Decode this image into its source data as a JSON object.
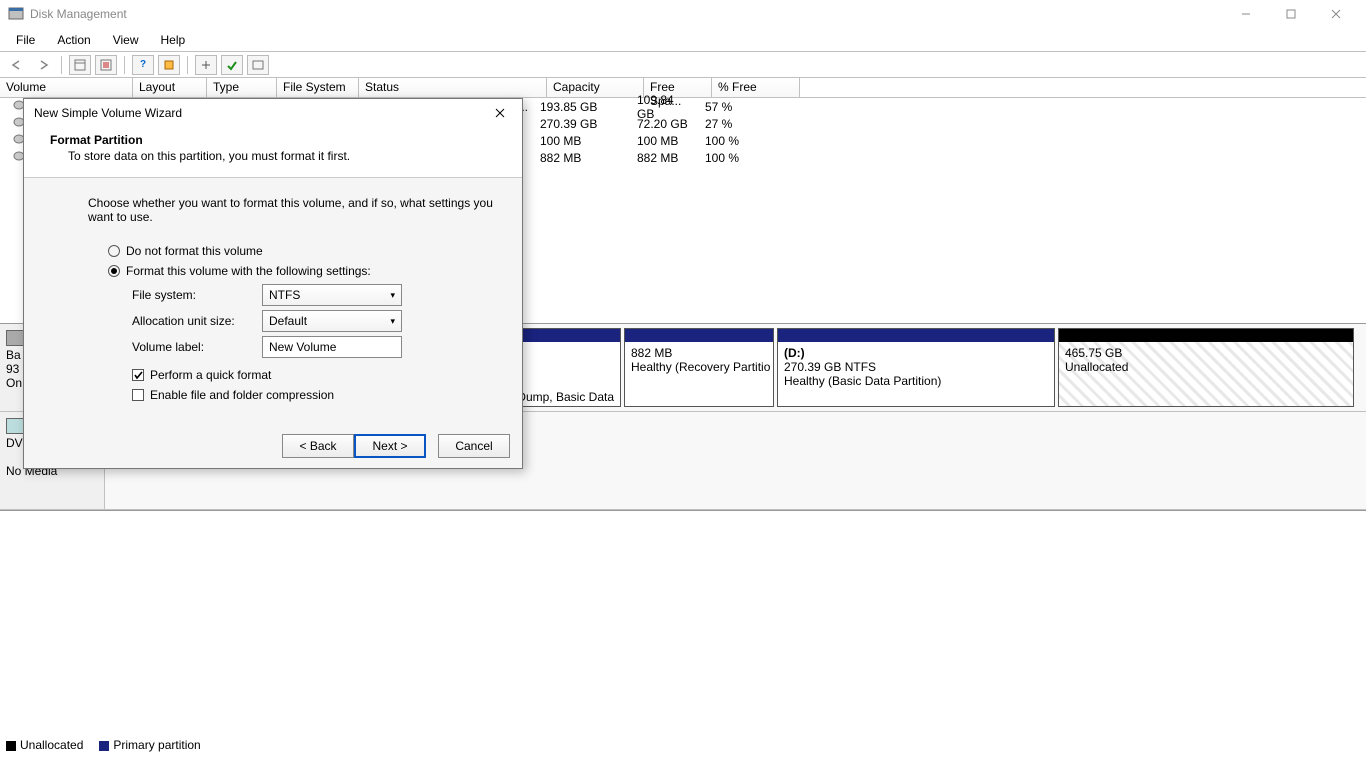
{
  "window": {
    "title": "Disk Management"
  },
  "menubar": {
    "items": [
      "File",
      "Action",
      "View",
      "Help"
    ]
  },
  "columns": {
    "volume": "Volume",
    "layout": "Layout",
    "type": "Type",
    "fs": "File System",
    "status": "Status",
    "capacity": "Capacity",
    "freespace": "Free Spa...",
    "pctfree": "% Free"
  },
  "vol_rows": [
    {
      "status_tail": "n ...",
      "capacity": "193.85 GB",
      "free": "109.84 GB",
      "pct": "57 %"
    },
    {
      "status_tail": "",
      "capacity": "270.39 GB",
      "free": "72.20 GB",
      "pct": "27 %"
    },
    {
      "status_tail": "",
      "capacity": "100 MB",
      "free": "100 MB",
      "pct": "100 %"
    },
    {
      "status_tail": "",
      "capacity": "882 MB",
      "free": "882 MB",
      "pct": "100 %"
    }
  ],
  "disk0": {
    "label_prefix": "Ba",
    "size_prefix": "93",
    "status_prefix": "On",
    "parts": [
      {
        "tail": "Dump, Basic Data"
      },
      {
        "size": "882 MB",
        "status": "Healthy (Recovery Partitio"
      },
      {
        "name": "(D:)",
        "detail": "270.39 GB NTFS",
        "status": "Healthy (Basic Data Partition)"
      },
      {
        "size": "465.75 GB",
        "status": "Unallocated"
      }
    ]
  },
  "cdrom": {
    "label_prefix": "DV",
    "nomedia": "No Media"
  },
  "legend": {
    "unalloc": "Unallocated",
    "primary": "Primary partition"
  },
  "wizard": {
    "title": "New Simple Volume Wizard",
    "head": "Format Partition",
    "sub": "To store data on this partition, you must format it first.",
    "desc": "Choose whether you want to format this volume, and if so, what settings you want to use.",
    "opt1": "Do not format this volume",
    "opt2": "Format this volume with the following settings:",
    "fs_label": "File system:",
    "fs_value": "NTFS",
    "au_label": "Allocation unit size:",
    "au_value": "Default",
    "vl_label": "Volume label:",
    "vl_value": "New Volume",
    "quick": "Perform a quick format",
    "compress": "Enable file and folder compression",
    "back": "< Back",
    "next": "Next >",
    "cancel": "Cancel"
  }
}
